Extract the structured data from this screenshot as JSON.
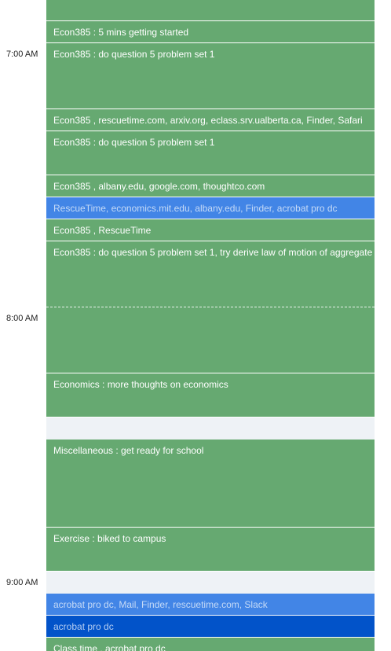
{
  "time_labels": [
    "7:00 AM",
    "8:00 AM",
    "9:00 AM"
  ],
  "events": [
    {
      "label": "",
      "color": "#66a971"
    },
    {
      "label": "Econ385 : 5 mins getting started",
      "color": "#66a971"
    },
    {
      "label": "Econ385 : do question 5 problem set 1",
      "color": "#66a971"
    },
    {
      "label": "Econ385 , rescuetime.com, arxiv.org, eclass.srv.ualberta.ca, Finder, Safari",
      "color": "#66a971"
    },
    {
      "label": "Econ385 : do question 5 problem set 1",
      "color": "#66a971"
    },
    {
      "label": "Econ385 , albany.edu, google.com, thoughtco.com",
      "color": "#66a971"
    },
    {
      "label": "RescueTime, economics.mit.edu, albany.edu, Finder, acrobat pro dc",
      "color": "#4285e6"
    },
    {
      "label": "Econ385 , RescueTime",
      "color": "#66a971"
    },
    {
      "label": "Econ385 : do question 5 problem set 1, try derive law of motion of aggregate",
      "color": "#66a971"
    },
    {
      "label": "Economics : more thoughts on economics",
      "color": "#66a971"
    },
    {
      "label": "Miscellaneous : get ready for school",
      "color": "#66a971"
    },
    {
      "label": "Exercise : biked to campus",
      "color": "#66a971"
    },
    {
      "label": "acrobat pro dc, Mail, Finder, rescuetime.com, Slack",
      "color": "#4285e6"
    },
    {
      "label": "acrobat pro dc",
      "color": "#0253c9"
    },
    {
      "label": "Class time , acrobat pro dc",
      "color": "#66a971"
    }
  ]
}
